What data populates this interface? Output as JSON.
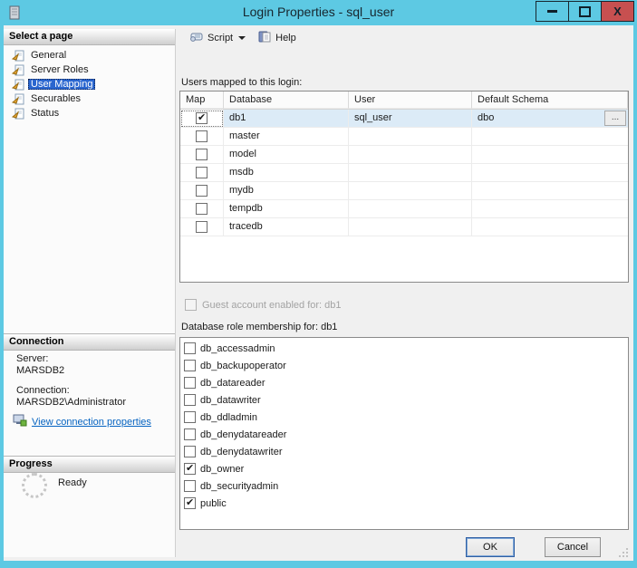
{
  "colors": {
    "titlebar": "#5dc9e3",
    "close": "#c75050",
    "accent": "#2a66cf",
    "rowsel": "#dcebf7",
    "link": "#0563c1"
  },
  "window": {
    "title": "Login Properties - sql_user",
    "close_glyph": "X"
  },
  "sidebar": {
    "select_header": "Select a page",
    "pages": [
      {
        "label": "General",
        "selected": false
      },
      {
        "label": "Server Roles",
        "selected": false
      },
      {
        "label": "User Mapping",
        "selected": true
      },
      {
        "label": "Securables",
        "selected": false
      },
      {
        "label": "Status",
        "selected": false
      }
    ],
    "connection_header": "Connection",
    "server_label": "Server:",
    "server_value": "MARSDB2",
    "connection_label": "Connection:",
    "connection_value": "MARSDB2\\Administrator",
    "view_connection_link": "View connection properties",
    "progress_header": "Progress",
    "progress_status": "Ready"
  },
  "toolbar": {
    "script_label": "Script",
    "help_label": "Help"
  },
  "main": {
    "users_mapped_label": "Users mapped to this login:",
    "table": {
      "columns": [
        "Map",
        "Database",
        "User",
        "Default Schema"
      ],
      "ellipsis_label": "...",
      "rows": [
        {
          "map": true,
          "database": "db1",
          "user": "sql_user",
          "default_schema": "dbo",
          "selected": true,
          "has_ellipsis": true
        },
        {
          "map": false,
          "database": "master",
          "user": "",
          "default_schema": "",
          "selected": false,
          "has_ellipsis": false
        },
        {
          "map": false,
          "database": "model",
          "user": "",
          "default_schema": "",
          "selected": false,
          "has_ellipsis": false
        },
        {
          "map": false,
          "database": "msdb",
          "user": "",
          "default_schema": "",
          "selected": false,
          "has_ellipsis": false
        },
        {
          "map": false,
          "database": "mydb",
          "user": "",
          "default_schema": "",
          "selected": false,
          "has_ellipsis": false
        },
        {
          "map": false,
          "database": "tempdb",
          "user": "",
          "default_schema": "",
          "selected": false,
          "has_ellipsis": false
        },
        {
          "map": false,
          "database": "tracedb",
          "user": "",
          "default_schema": "",
          "selected": false,
          "has_ellipsis": false
        }
      ]
    },
    "guest_label": "Guest account enabled for: db1",
    "guest_checked": false,
    "role_membership_label": "Database role membership for: db1",
    "roles": [
      {
        "name": "db_accessadmin",
        "checked": false
      },
      {
        "name": "db_backupoperator",
        "checked": false
      },
      {
        "name": "db_datareader",
        "checked": false
      },
      {
        "name": "db_datawriter",
        "checked": false
      },
      {
        "name": "db_ddladmin",
        "checked": false
      },
      {
        "name": "db_denydatareader",
        "checked": false
      },
      {
        "name": "db_denydatawriter",
        "checked": false
      },
      {
        "name": "db_owner",
        "checked": true
      },
      {
        "name": "db_securityadmin",
        "checked": false
      },
      {
        "name": "public",
        "checked": true
      }
    ]
  },
  "footer": {
    "ok_label": "OK",
    "cancel_label": "Cancel"
  }
}
